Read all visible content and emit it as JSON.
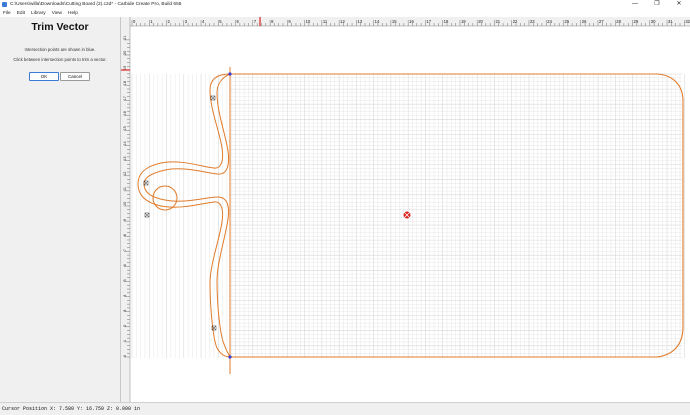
{
  "window": {
    "title": "C:\\Users\\willa\\Downloads\\Cutting Board (2).c2d* - Carbide Create Pro, Build 655",
    "minimize_glyph": "—",
    "maximize_glyph": "❐",
    "close_glyph": "✕",
    "app_icon": "carbide-create-icon"
  },
  "menu": [
    "File",
    "Edit",
    "Library",
    "View",
    "Help"
  ],
  "panel": {
    "title": "Trim Vector",
    "line1": "Intersection points are shown in blue.",
    "line2": "Click between intersection points to trim a vector.",
    "ok_label": "OK",
    "cancel_label": "Cancel"
  },
  "rulers": {
    "top_labels": [
      "0",
      "1",
      "2",
      "3",
      "4",
      "5",
      "6",
      "7",
      "8",
      "9",
      "10",
      "11",
      "12",
      "13",
      "14",
      "15",
      "16",
      "17",
      "18",
      "19",
      "20",
      "21",
      "22",
      "23",
      "24",
      "25",
      "26",
      "27",
      "28",
      "29",
      "30",
      "31",
      "32"
    ],
    "left_labels": [
      "0",
      "1",
      "2",
      "3",
      "4",
      "5",
      "6",
      "7",
      "8",
      "9",
      "10",
      "11",
      "12",
      "13",
      "14",
      "15",
      "16",
      "17",
      "18",
      "19",
      "20",
      "21"
    ]
  },
  "colors": {
    "accent": "#3a7bd5",
    "vector": "#e07b2a",
    "grid": "#d6d6d6",
    "marker": "#e02020"
  },
  "status": {
    "text": "Cursor Position X: 7.580 Y: 16.750 Z: 0.000 in"
  }
}
